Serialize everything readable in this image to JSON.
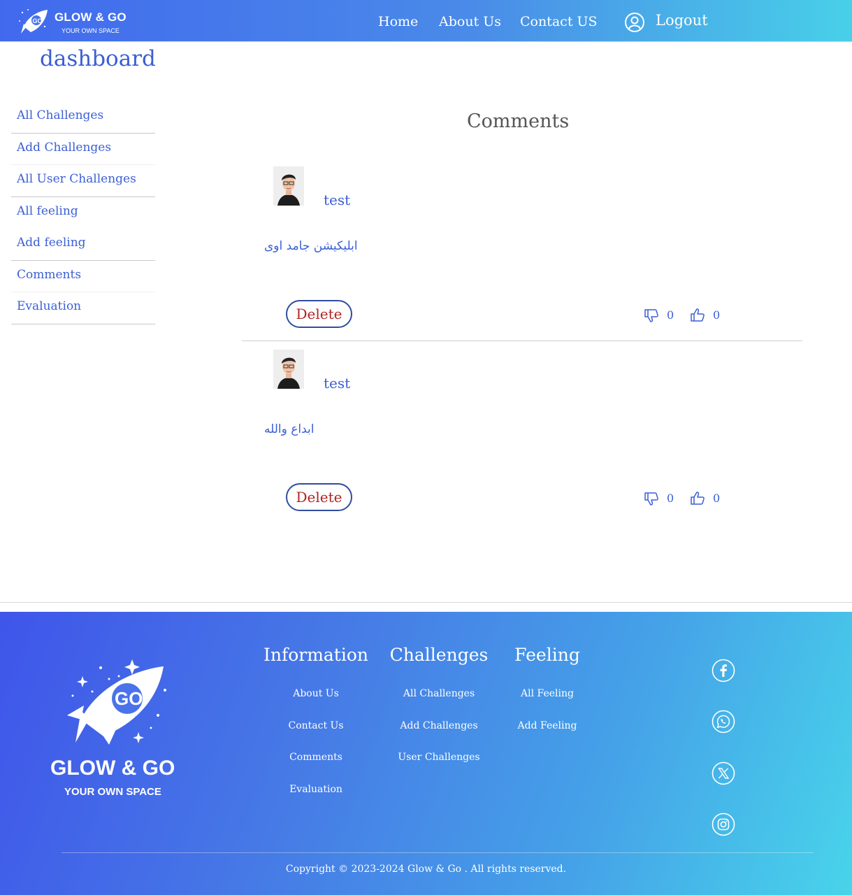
{
  "header": {
    "logo_title": "GLOW & GO",
    "logo_subtitle": "YOUR OWN SPACE",
    "nav": {
      "home": "Home",
      "about": "About Us",
      "contact": "Contact US"
    },
    "logout_label": "Logout"
  },
  "sidebar": {
    "title": "dashboard",
    "items": [
      {
        "label": "All Challenges"
      },
      {
        "label": "Add Challenges"
      },
      {
        "label": "All User Challenges"
      },
      {
        "label": "All feeling"
      },
      {
        "label": "Add feeling"
      },
      {
        "label": "Comments"
      },
      {
        "label": "Evaluation"
      }
    ]
  },
  "main": {
    "title": "Comments",
    "comments": [
      {
        "username": "test",
        "text": "ابليكيشن جامد اوى",
        "delete_label": "Delete",
        "dislikes": "0",
        "likes": "0"
      },
      {
        "username": "test",
        "text": "ابداع والله",
        "delete_label": "Delete",
        "dislikes": "0",
        "likes": "0"
      }
    ]
  },
  "footer": {
    "logo_title": "GLOW & GO",
    "logo_subtitle": "YOUR OWN SPACE",
    "columns": {
      "information": {
        "heading": "Information",
        "links": [
          "About Us",
          "Contact Us",
          "Comments",
          "Evaluation"
        ]
      },
      "challenges": {
        "heading": "Challenges",
        "links": [
          "All Challenges",
          "Add Challenges",
          "User Challenges"
        ]
      },
      "feeling": {
        "heading": "Feeling",
        "links": [
          "All Feeling",
          "Add Feeling"
        ]
      }
    },
    "social_icons": [
      "facebook-icon",
      "whatsapp-icon",
      "x-icon",
      "instagram-icon"
    ],
    "copyright": "Copyright © 2023-2024 Glow & Go . All rights reserved."
  },
  "colors": {
    "accent": "#3a5fd4",
    "delete_text": "#b22222",
    "header_gradient_start": "#4169ee",
    "header_gradient_end": "#48d0e8"
  }
}
